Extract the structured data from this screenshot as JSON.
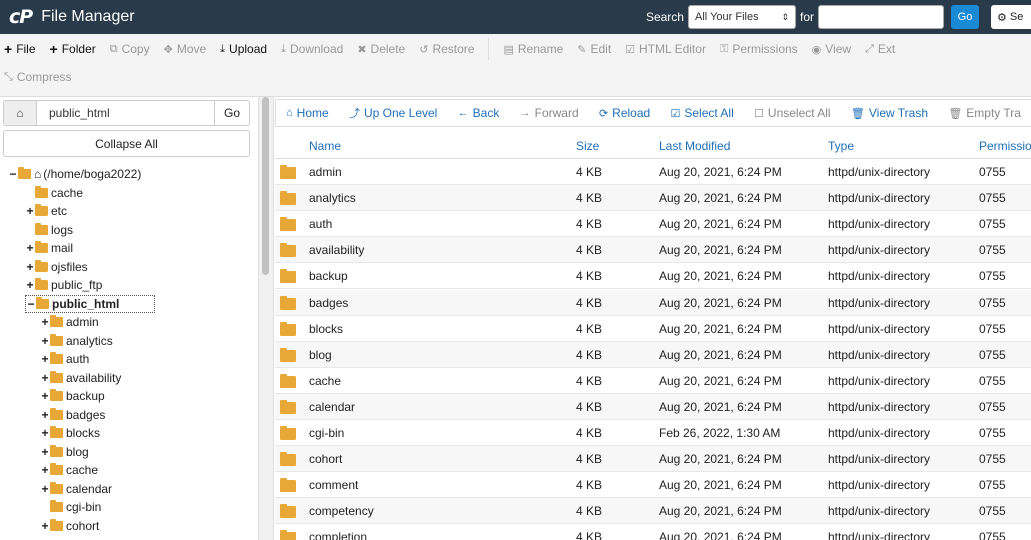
{
  "header": {
    "logo": "cP",
    "title": "File Manager",
    "search_label": "Search",
    "search_scope": "All Your Files",
    "for_label": "for",
    "search_value": "",
    "go_label": "Go",
    "settings_label": "Se"
  },
  "toolbar": {
    "row1": [
      {
        "icon": "+",
        "label": "File",
        "enabled": true,
        "name": "new-file"
      },
      {
        "icon": "+",
        "label": "Folder",
        "enabled": true,
        "name": "new-folder"
      },
      {
        "icon": "⧉",
        "label": "Copy",
        "enabled": false,
        "name": "copy"
      },
      {
        "icon": "✥",
        "label": "Move",
        "enabled": false,
        "name": "move"
      },
      {
        "icon": "⤓",
        "label": "Upload",
        "enabled": true,
        "name": "upload"
      },
      {
        "icon": "⤓",
        "label": "Download",
        "enabled": false,
        "name": "download"
      },
      {
        "icon": "✖",
        "label": "Delete",
        "enabled": false,
        "name": "delete"
      },
      {
        "icon": "↺",
        "label": "Restore",
        "enabled": false,
        "name": "restore"
      },
      {
        "icon": "▤",
        "label": "Rename",
        "enabled": false,
        "name": "rename"
      },
      {
        "icon": "✎",
        "label": "Edit",
        "enabled": false,
        "name": "edit"
      },
      {
        "icon": "☑",
        "label": "HTML Editor",
        "enabled": false,
        "name": "html-editor"
      },
      {
        "icon": "⚿",
        "label": "Permissions",
        "enabled": false,
        "name": "permissions"
      },
      {
        "icon": "◉",
        "label": "View",
        "enabled": false,
        "name": "view"
      },
      {
        "icon": "⤢",
        "label": "Ext",
        "enabled": false,
        "name": "extract"
      }
    ],
    "row2": [
      {
        "icon": "⤡",
        "label": "Compress",
        "enabled": false,
        "name": "compress"
      }
    ]
  },
  "left": {
    "path_value": "public_html",
    "go_label": "Go",
    "collapse_label": "Collapse All",
    "tree": [
      {
        "toggle": "−",
        "label": "(/home/boga2022)",
        "indent": 0,
        "home": true
      },
      {
        "toggle": "",
        "label": "cache",
        "indent": 1
      },
      {
        "toggle": "+",
        "label": "etc",
        "indent": 1
      },
      {
        "toggle": "",
        "label": "logs",
        "indent": 1
      },
      {
        "toggle": "+",
        "label": "mail",
        "indent": 1
      },
      {
        "toggle": "+",
        "label": "ojsfiles",
        "indent": 1
      },
      {
        "toggle": "+",
        "label": "public_ftp",
        "indent": 1
      },
      {
        "toggle": "−",
        "label": "public_html",
        "indent": 1,
        "selected": true
      },
      {
        "toggle": "+",
        "label": "admin",
        "indent": 2
      },
      {
        "toggle": "+",
        "label": "analytics",
        "indent": 2
      },
      {
        "toggle": "+",
        "label": "auth",
        "indent": 2
      },
      {
        "toggle": "+",
        "label": "availability",
        "indent": 2
      },
      {
        "toggle": "+",
        "label": "backup",
        "indent": 2
      },
      {
        "toggle": "+",
        "label": "badges",
        "indent": 2
      },
      {
        "toggle": "+",
        "label": "blocks",
        "indent": 2
      },
      {
        "toggle": "+",
        "label": "blog",
        "indent": 2
      },
      {
        "toggle": "+",
        "label": "cache",
        "indent": 2
      },
      {
        "toggle": "+",
        "label": "calendar",
        "indent": 2
      },
      {
        "toggle": "",
        "label": "cgi-bin",
        "indent": 2
      },
      {
        "toggle": "+",
        "label": "cohort",
        "indent": 2
      }
    ]
  },
  "nav": {
    "items": [
      {
        "icon": "⌂",
        "label": "Home",
        "enabled": true,
        "name": "home"
      },
      {
        "icon": "⤴",
        "label": "Up One Level",
        "enabled": true,
        "name": "up-one-level"
      },
      {
        "icon": "←",
        "label": "Back",
        "enabled": true,
        "name": "back"
      },
      {
        "icon": "→",
        "label": "Forward",
        "enabled": false,
        "name": "forward"
      },
      {
        "icon": "⟳",
        "label": "Reload",
        "enabled": true,
        "name": "reload"
      },
      {
        "icon": "☑",
        "label": "Select All",
        "enabled": true,
        "name": "select-all"
      },
      {
        "icon": "☐",
        "label": "Unselect All",
        "enabled": false,
        "name": "unselect-all"
      },
      {
        "icon": "🗑",
        "label": "View Trash",
        "enabled": true,
        "name": "view-trash"
      },
      {
        "icon": "🗑",
        "label": "Empty Tra",
        "enabled": false,
        "name": "empty-trash"
      }
    ]
  },
  "table": {
    "headers": {
      "name": "Name",
      "size": "Size",
      "modified": "Last Modified",
      "type": "Type",
      "perms": "Permissio"
    },
    "rows": [
      {
        "name": "admin",
        "size": "4 KB",
        "modified": "Aug 20, 2021, 6:24 PM",
        "type": "httpd/unix-directory",
        "perms": "0755"
      },
      {
        "name": "analytics",
        "size": "4 KB",
        "modified": "Aug 20, 2021, 6:24 PM",
        "type": "httpd/unix-directory",
        "perms": "0755"
      },
      {
        "name": "auth",
        "size": "4 KB",
        "modified": "Aug 20, 2021, 6:24 PM",
        "type": "httpd/unix-directory",
        "perms": "0755"
      },
      {
        "name": "availability",
        "size": "4 KB",
        "modified": "Aug 20, 2021, 6:24 PM",
        "type": "httpd/unix-directory",
        "perms": "0755"
      },
      {
        "name": "backup",
        "size": "4 KB",
        "modified": "Aug 20, 2021, 6:24 PM",
        "type": "httpd/unix-directory",
        "perms": "0755"
      },
      {
        "name": "badges",
        "size": "4 KB",
        "modified": "Aug 20, 2021, 6:24 PM",
        "type": "httpd/unix-directory",
        "perms": "0755"
      },
      {
        "name": "blocks",
        "size": "4 KB",
        "modified": "Aug 20, 2021, 6:24 PM",
        "type": "httpd/unix-directory",
        "perms": "0755"
      },
      {
        "name": "blog",
        "size": "4 KB",
        "modified": "Aug 20, 2021, 6:24 PM",
        "type": "httpd/unix-directory",
        "perms": "0755"
      },
      {
        "name": "cache",
        "size": "4 KB",
        "modified": "Aug 20, 2021, 6:24 PM",
        "type": "httpd/unix-directory",
        "perms": "0755"
      },
      {
        "name": "calendar",
        "size": "4 KB",
        "modified": "Aug 20, 2021, 6:24 PM",
        "type": "httpd/unix-directory",
        "perms": "0755"
      },
      {
        "name": "cgi-bin",
        "size": "4 KB",
        "modified": "Feb 26, 2022, 1:30 AM",
        "type": "httpd/unix-directory",
        "perms": "0755"
      },
      {
        "name": "cohort",
        "size": "4 KB",
        "modified": "Aug 20, 2021, 6:24 PM",
        "type": "httpd/unix-directory",
        "perms": "0755"
      },
      {
        "name": "comment",
        "size": "4 KB",
        "modified": "Aug 20, 2021, 6:24 PM",
        "type": "httpd/unix-directory",
        "perms": "0755"
      },
      {
        "name": "competency",
        "size": "4 KB",
        "modified": "Aug 20, 2021, 6:24 PM",
        "type": "httpd/unix-directory",
        "perms": "0755"
      },
      {
        "name": "completion",
        "size": "4 KB",
        "modified": "Aug 20, 2021, 6:24 PM",
        "type": "httpd/unix-directory",
        "perms": "0755"
      }
    ]
  },
  "colors": {
    "header_bg": "#293a4a",
    "accent": "#1d6fb8",
    "folder": "#e8a838",
    "go_button": "#1a8ad6"
  }
}
